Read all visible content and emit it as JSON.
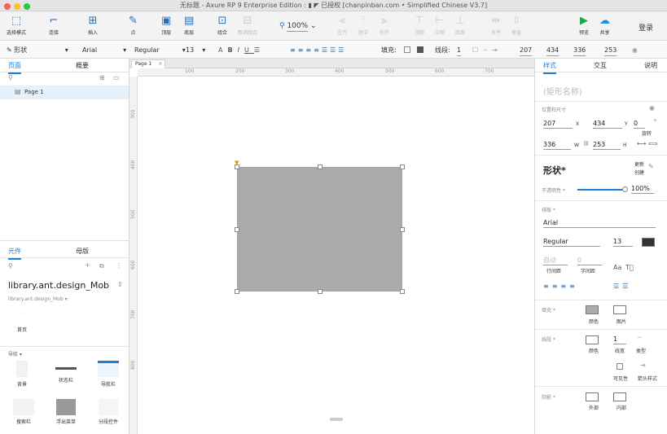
{
  "window": {
    "title": "无标题 - Axure RP 9 Enterprise Edition : ▮ ◤ 已授权    [chanpinban.com • Simplified Chinese V3.7]"
  },
  "toolbar": {
    "select_mode": "选择模式",
    "connect": "连接",
    "insert": "插入",
    "point": "点",
    "top": "顶层",
    "bottom": "底层",
    "group": "组合",
    "ungroup": "取消组合",
    "zoom": "100%",
    "left_align": "左齐",
    "center": "居中",
    "right_align": "右齐",
    "top_align": "顶部",
    "middle": "中部",
    "bottom_align": "底部",
    "horizontal": "水平",
    "vertical": "垂直",
    "preview": "预览",
    "share": "共享",
    "login": "登录"
  },
  "format": {
    "style": "形状",
    "font": "Arial",
    "weight": "Regular",
    "size": "13",
    "fill": "填充:",
    "line": "线段:",
    "line_width": "1",
    "x": "207",
    "y": "434",
    "w": "336",
    "h": "253"
  },
  "left": {
    "tab_pages": "页面",
    "tab_outline": "概要",
    "page1": "Page 1",
    "tab_components": "元件",
    "tab_masters": "母版",
    "library": "library.ant.design_Mob",
    "library_sub": "library.ant.design_Mob ▾",
    "home": "首页",
    "nav_section": "导航 ▾",
    "comp_bg": "背景",
    "comp_status": "状态栏",
    "comp_nav": "导航栏",
    "comp_search": "搜索栏",
    "comp_float": "浮出菜单",
    "comp_seg": "分段控件"
  },
  "canvas": {
    "tab": "Page 1",
    "ruler_h": [
      "100",
      "200",
      "300",
      "400",
      "500",
      "600",
      "700"
    ],
    "ruler_v": [
      "300",
      "400",
      "500",
      "600",
      "700",
      "800"
    ]
  },
  "right": {
    "tab_style": "样式",
    "tab_interact": "交互",
    "tab_notes": "说明",
    "name_placeholder": "(矩形名称)",
    "pos_size": "位置和尺寸",
    "x": "207",
    "y": "434",
    "rot": "0",
    "rot_unit": "°",
    "rot_label": "旋转",
    "w": "336",
    "h": "253",
    "x_l": "X",
    "y_l": "Y",
    "w_l": "W",
    "h_l": "H",
    "style_name": "形状*",
    "update": "更新",
    "create": "创建",
    "opacity_l": "不透明性 *",
    "opacity": "100%",
    "typo": "排版 *",
    "font": "Arial",
    "weight": "Regular",
    "size": "13",
    "auto": "自动",
    "line_spacing": "行间距",
    "zero": "0",
    "char_spacing": "字间距",
    "fill_l": "填充 *",
    "color": "颜色",
    "image": "图片",
    "border_l": "线段 *",
    "border_width": "1",
    "width_l": "线宽",
    "type_l": "类型",
    "visibility": "可见性",
    "arrow": "箭头样式",
    "shadow_l": "阴影 *",
    "outer": "外部",
    "inner": "内部"
  },
  "colors": {
    "accent": "#1d7fd8",
    "shape_fill": "#aaaaaa",
    "selection": "#61c0d8"
  }
}
